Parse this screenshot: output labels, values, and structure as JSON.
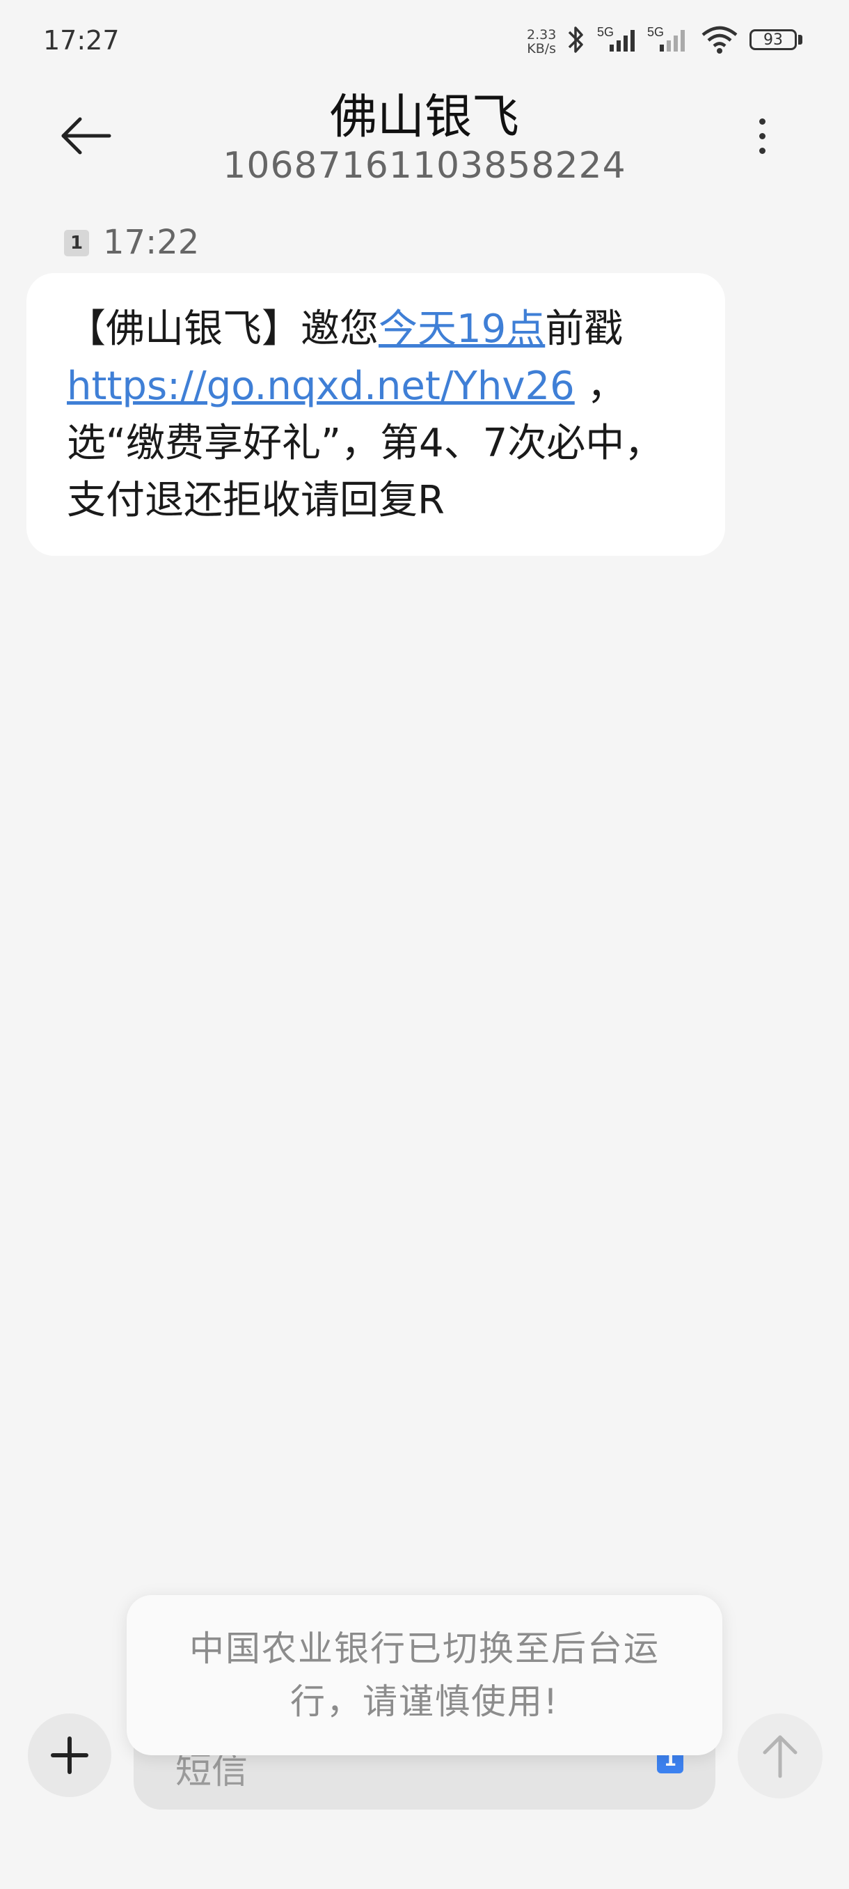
{
  "status_bar": {
    "time": "17:27",
    "net_speed_value": "2.33",
    "net_speed_unit": "KB/s",
    "signal_1_label": "5G",
    "signal_2_label": "5G",
    "battery": "93"
  },
  "header": {
    "title": "佛山银飞",
    "phone_number": "10687161103858224"
  },
  "message": {
    "sim_badge": "1",
    "time": "17:22",
    "text_part_1": "【佛山银飞】邀您",
    "link_time": "今天19点",
    "text_part_2": "前戳",
    "link_url": "https://go.nqxd.net/Yhv26",
    "text_part_3": " ，选“缴费享好礼”，第4、7次必中，支付退还拒收请回复R"
  },
  "composer": {
    "placeholder": "短信",
    "sim_badge": "1"
  },
  "toast": {
    "text": "中国农业银行已切换至后台运行，请谨慎使用!"
  },
  "colors": {
    "link": "#3f7fd6",
    "accent": "#3d82f0",
    "background": "#f5f5f5"
  }
}
